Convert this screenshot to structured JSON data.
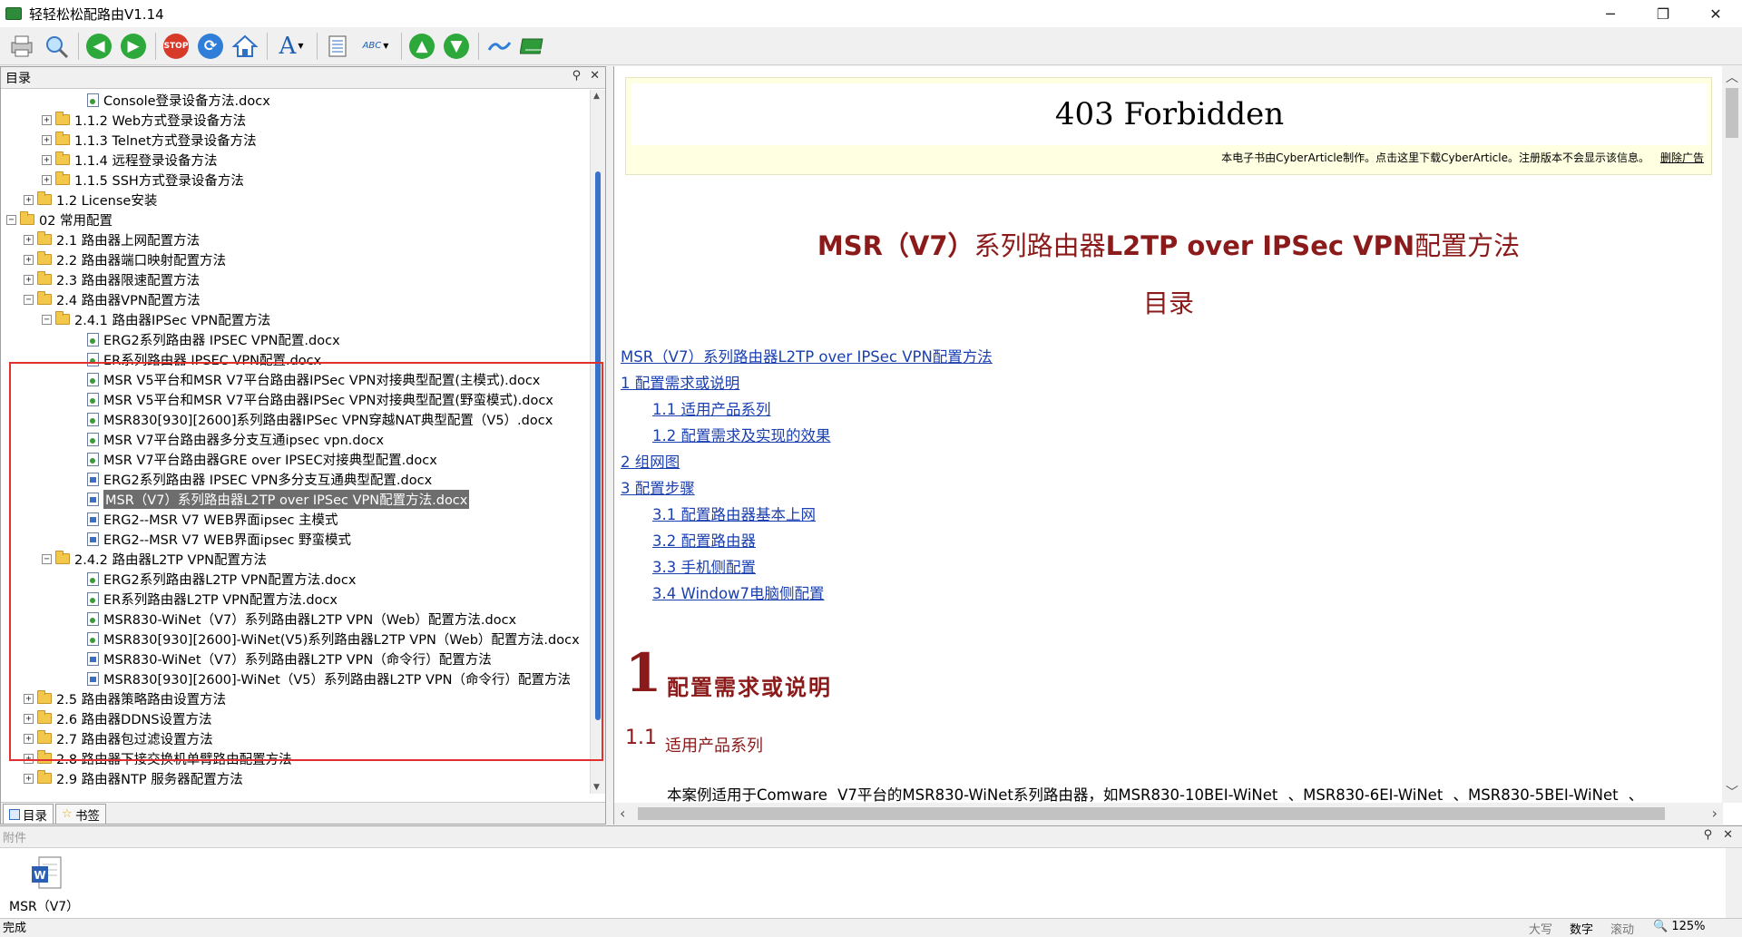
{
  "window": {
    "title": "轻轻松松配路由V1.14",
    "min": "─",
    "max": "❐",
    "close": "✕"
  },
  "toolbar": {
    "stop_label": "STOP",
    "font_label": "A",
    "abc_label": "ABC"
  },
  "left_panel": {
    "title": "目录",
    "tree": [
      {
        "label": "Console登录设备方法.docx",
        "type": "doc",
        "icon": "green"
      },
      {
        "label": "1.1.2 Web方式登录设备方法",
        "type": "folder"
      },
      {
        "label": "1.1.3 Telnet方式登录设备方法",
        "type": "folder"
      },
      {
        "label": "1.1.4 远程登录设备方法",
        "type": "folder"
      },
      {
        "label": "1.1.5 SSH方式登录设备方法",
        "type": "folder"
      },
      {
        "label": "1.2 License安装",
        "type": "folder"
      },
      {
        "label": "02 常用配置",
        "type": "folder"
      },
      {
        "label": "2.1 路由器上网配置方法",
        "type": "folder"
      },
      {
        "label": "2.2 路由器端口映射配置方法",
        "type": "folder"
      },
      {
        "label": "2.3 路由器限速配置方法",
        "type": "folder"
      },
      {
        "label": "2.4 路由器VPN配置方法",
        "type": "folder"
      },
      {
        "label": "2.4.1 路由器IPSec VPN配置方法",
        "type": "folder"
      },
      {
        "label": "ERG2系列路由器 IPSEC VPN配置.docx",
        "type": "doc",
        "icon": "green"
      },
      {
        "label": "ER系列路由器 IPSEC VPN配置.docx",
        "type": "doc",
        "icon": "green"
      },
      {
        "label": "MSR V5平台和MSR V7平台路由器IPSec VPN对接典型配置(主模式).docx",
        "type": "doc",
        "icon": "green"
      },
      {
        "label": "MSR V5平台和MSR V7平台路由器IPSec VPN对接典型配置(野蛮模式).docx",
        "type": "doc",
        "icon": "green"
      },
      {
        "label": "MSR830[930][2600]系列路由器IPSec VPN穿越NAT典型配置（V5）.docx",
        "type": "doc",
        "icon": "green"
      },
      {
        "label": "MSR V7平台路由器多分支互通ipsec vpn.docx",
        "type": "doc",
        "icon": "green"
      },
      {
        "label": "MSR V7平台路由器GRE over IPSEC对接典型配置.docx",
        "type": "doc",
        "icon": "green"
      },
      {
        "label": "ERG2系列路由器 IPSEC VPN多分支互通典型配置.docx",
        "type": "doc",
        "icon": "blue"
      },
      {
        "label": "MSR（V7）系列路由器L2TP over IPSec VPN配置方法.docx",
        "type": "doc",
        "icon": "blue",
        "selected": true
      },
      {
        "label": "ERG2--MSR V7 WEB界面ipsec 主模式",
        "type": "doc",
        "icon": "blue"
      },
      {
        "label": "ERG2--MSR V7 WEB界面ipsec 野蛮模式",
        "type": "doc",
        "icon": "blue"
      },
      {
        "label": "2.4.2 路由器L2TP VPN配置方法",
        "type": "folder"
      },
      {
        "label": "ERG2系列路由器L2TP VPN配置方法.docx",
        "type": "doc",
        "icon": "green"
      },
      {
        "label": "ER系列路由器L2TP VPN配置方法.docx",
        "type": "doc",
        "icon": "green"
      },
      {
        "label": "MSR830-WiNet（V7）系列路由器L2TP VPN（Web）配置方法.docx",
        "type": "doc",
        "icon": "green"
      },
      {
        "label": "MSR830[930][2600]-WiNet(V5)系列路由器L2TP VPN（Web）配置方法.docx",
        "type": "doc",
        "icon": "green"
      },
      {
        "label": "MSR830-WiNet（V7）系列路由器L2TP VPN（命令行）配置方法",
        "type": "doc",
        "icon": "blue"
      },
      {
        "label": "MSR830[930][2600]-WiNet（V5）系列路由器L2TP VPN（命令行）配置方法",
        "type": "doc",
        "icon": "blue"
      },
      {
        "label": "2.5 路由器策略路由设置方法",
        "type": "folder"
      },
      {
        "label": "2.6 路由器DDNS设置方法",
        "type": "folder"
      },
      {
        "label": "2.7 路由器包过滤设置方法",
        "type": "folder"
      },
      {
        "label": "2.8 路由器下接交换机单臂路由配置方法",
        "type": "folder"
      },
      {
        "label": "2.9 路由器NTP 服务器配置方法",
        "type": "folder"
      }
    ],
    "tabs": {
      "toc": "目录",
      "bookmark": "书签"
    }
  },
  "document": {
    "banner_title": "403 Forbidden",
    "banner_note": "本电子书由CyberArticle制作。点击这里下载CyberArticle。注册版本不会显示该信息。",
    "banner_remove": "删除广告",
    "title_a": "MSR（V7）",
    "title_b": "系列路由器",
    "title_c": "L2TP over IPSec VPN",
    "title_d": "配置方法",
    "toc_heading": "目录",
    "toc": [
      "MSR（V7）系列路由器L2TP over IPSec VPN配置方法",
      "1 配置需求或说明",
      "1.1 适用产品系列",
      "1.2 配置需求及实现的效果",
      "2 组网图",
      "3 配置步骤",
      "3.1 配置路由器基本上网",
      "3.2  配置路由器",
      "3.3 手机侧配置",
      "3.4 Window7电脑侧配置"
    ],
    "section_num": "1",
    "section_title": "配置需求或说明",
    "sub_num": "1.1",
    "sub_title": "适用产品系列",
    "paragraph": "本案例适用于Comware V7平台的MSR830-WiNet系列路由器，如MSR830-10BEI-WiNet 、MSR830-6EI-WiNet 、MSR830-5BEI-WiNet 、"
  },
  "attachment": {
    "title": "附件",
    "file_label": "MSR（V7）",
    "file_icon_letter": "W"
  },
  "status": {
    "left": "完成",
    "caps": "大写",
    "num": "数字",
    "scroll": "滚动",
    "zoom": "125%"
  }
}
